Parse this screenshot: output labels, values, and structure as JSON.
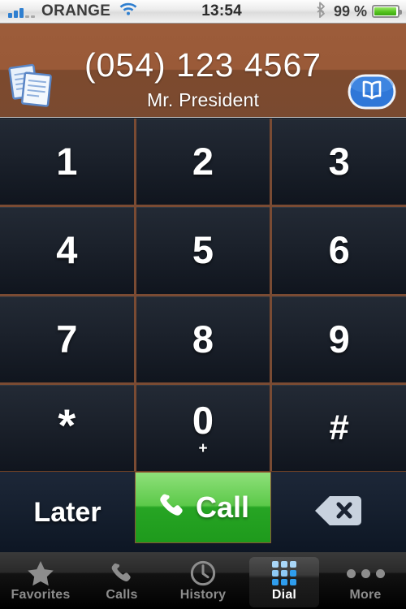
{
  "status_bar": {
    "signal_icon": "signal-bars-icon",
    "signal_bars_filled": 3,
    "signal_bars_empty": 2,
    "carrier": "ORANGE",
    "wifi_icon": "wifi-icon",
    "time": "13:54",
    "bluetooth_icon": "bluetooth-icon",
    "battery_text": "99 %",
    "battery_icon": "battery-icon",
    "battery_level": 99
  },
  "header": {
    "notes_icon": "documents-icon",
    "contacts_icon": "address-book-icon",
    "phone_number": "(054) 123 4567",
    "contact_name": "Mr. President",
    "background_color": "#9a5a38",
    "background_color_bottom": "#7a4a30"
  },
  "keypad": {
    "keys": [
      {
        "digit": "1",
        "sub": ""
      },
      {
        "digit": "2",
        "sub": ""
      },
      {
        "digit": "3",
        "sub": ""
      },
      {
        "digit": "4",
        "sub": ""
      },
      {
        "digit": "5",
        "sub": ""
      },
      {
        "digit": "6",
        "sub": ""
      },
      {
        "digit": "7",
        "sub": ""
      },
      {
        "digit": "8",
        "sub": ""
      },
      {
        "digit": "9",
        "sub": ""
      },
      {
        "digit": "*",
        "sub": ""
      },
      {
        "digit": "0",
        "sub": "+"
      },
      {
        "digit": "#",
        "sub": ""
      }
    ],
    "key_color": "#1b212b",
    "separator_color": "#8a5c44"
  },
  "actions": {
    "later_label": "Later",
    "call_label": "Call",
    "call_icon": "phone-handset-icon",
    "call_color": "#2aae27",
    "delete_icon": "backspace-icon"
  },
  "tab_bar": {
    "selected": "Dial",
    "tabs": [
      {
        "label": "Favorites",
        "icon": "star-icon"
      },
      {
        "label": "Calls",
        "icon": "phone-handset-icon"
      },
      {
        "label": "History",
        "icon": "clock-icon"
      },
      {
        "label": "Dial",
        "icon": "keypad-grid-icon"
      },
      {
        "label": "More",
        "icon": "ellipsis-icon"
      }
    ]
  }
}
